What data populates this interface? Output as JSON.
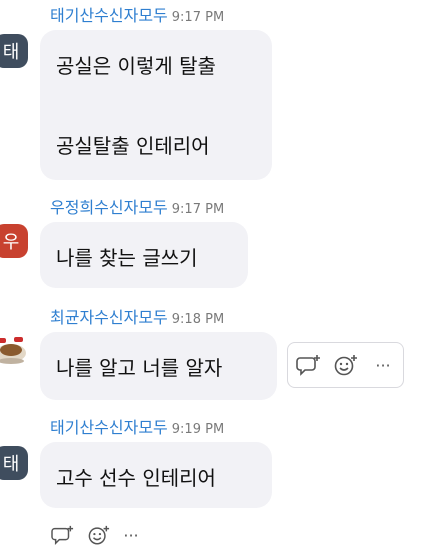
{
  "messages": [
    {
      "avatar_char": "태",
      "avatar_color": "#3f4d5e",
      "name": "태기산",
      "role": "수신자모두",
      "time": "9:17 PM",
      "lines": [
        "공실은 이렇게 탈출",
        "공실탈출 인테리어"
      ]
    },
    {
      "avatar_char": "우",
      "avatar_color": "#c8412f",
      "name": "우정희",
      "role": "수신자모두",
      "time": "9:17 PM",
      "lines": [
        "나를 찾는 글쓰기"
      ]
    },
    {
      "avatar_char": "",
      "avatar_color": "#ffffff",
      "name": "최균자",
      "role": "수신자모두",
      "time": "9:18 PM",
      "lines": [
        "나를 알고 너를 알자"
      ]
    },
    {
      "avatar_char": "태",
      "avatar_color": "#3f4d5e",
      "name": "태기산",
      "role": "수신자모두",
      "time": "9:19 PM",
      "lines": [
        "고수 선수 인테리어"
      ]
    }
  ],
  "actions": {
    "reply_icon": "reply-plus-icon",
    "react_icon": "emoji-plus-icon",
    "more_icon": "more-horizontal-icon",
    "more_label": "···"
  }
}
